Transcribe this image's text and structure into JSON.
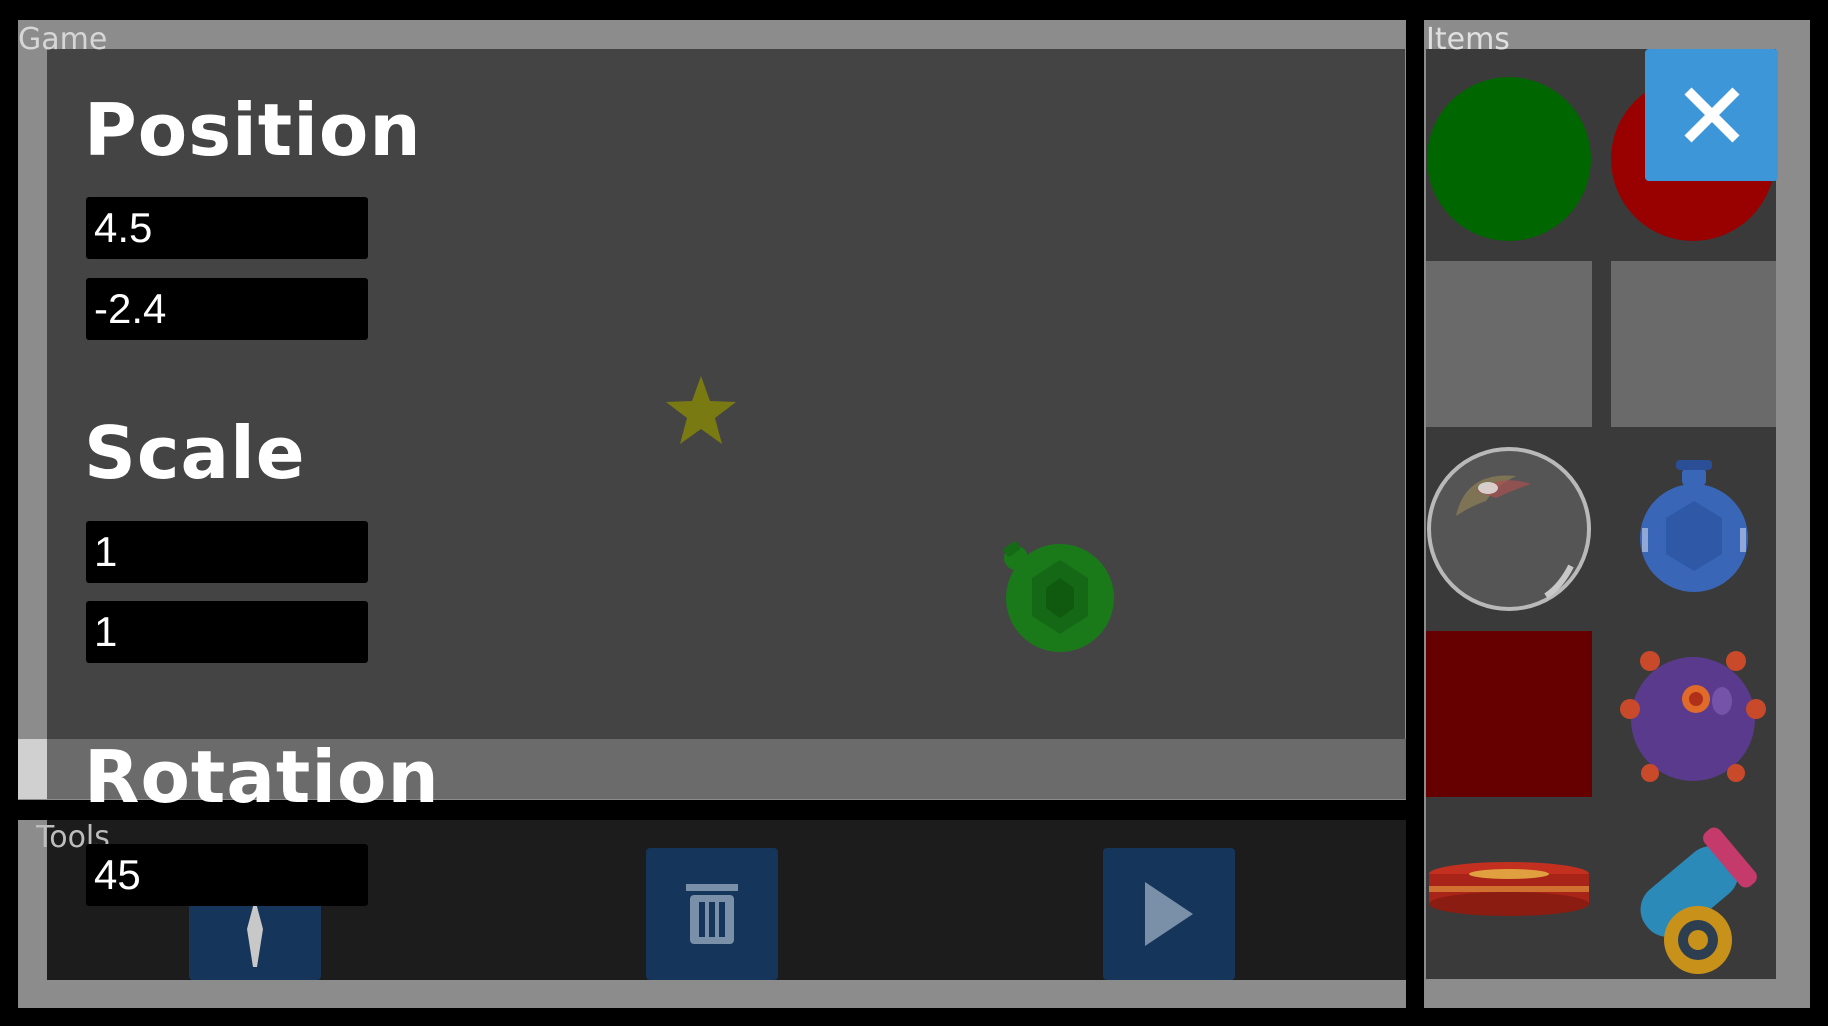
{
  "game_panel": {
    "title": "Game"
  },
  "tools_panel": {
    "title": "Tools"
  },
  "items_panel": {
    "title": "Items"
  },
  "inspector": {
    "position": {
      "label": "Position",
      "x": "4.5",
      "y": "-2.4"
    },
    "scale": {
      "label": "Scale",
      "x": "1",
      "y": "1"
    },
    "rotation": {
      "label": "Rotation",
      "value": "45"
    }
  },
  "tools": [
    {
      "name": "pin-tool",
      "icon": "pin-icon"
    },
    {
      "name": "delete-tool",
      "icon": "trash-icon"
    },
    {
      "name": "play-tool",
      "icon": "play-icon"
    }
  ],
  "items": [
    {
      "name": "green-circle",
      "color": "#006600"
    },
    {
      "name": "red-circle",
      "color": "#990000"
    },
    {
      "name": "empty-slot"
    },
    {
      "name": "empty-slot"
    },
    {
      "name": "bubble"
    },
    {
      "name": "blue-bottle",
      "color": "#3a66b8"
    },
    {
      "name": "red-square",
      "color": "#660000"
    },
    {
      "name": "spiked-mine",
      "color": "#5a3a8c"
    },
    {
      "name": "trampoline",
      "color": "#b02020"
    },
    {
      "name": "cannon",
      "color": "#2c8ab8"
    }
  ],
  "scene_objects": [
    {
      "name": "star",
      "color": "#7a7a12"
    },
    {
      "name": "green-bottle",
      "color": "#1a7a1a"
    }
  ],
  "colors": {
    "panel": "#8c8c8c",
    "viewport": "#444444",
    "tool_button": "#16355a",
    "close_button": "#3d96d8"
  }
}
